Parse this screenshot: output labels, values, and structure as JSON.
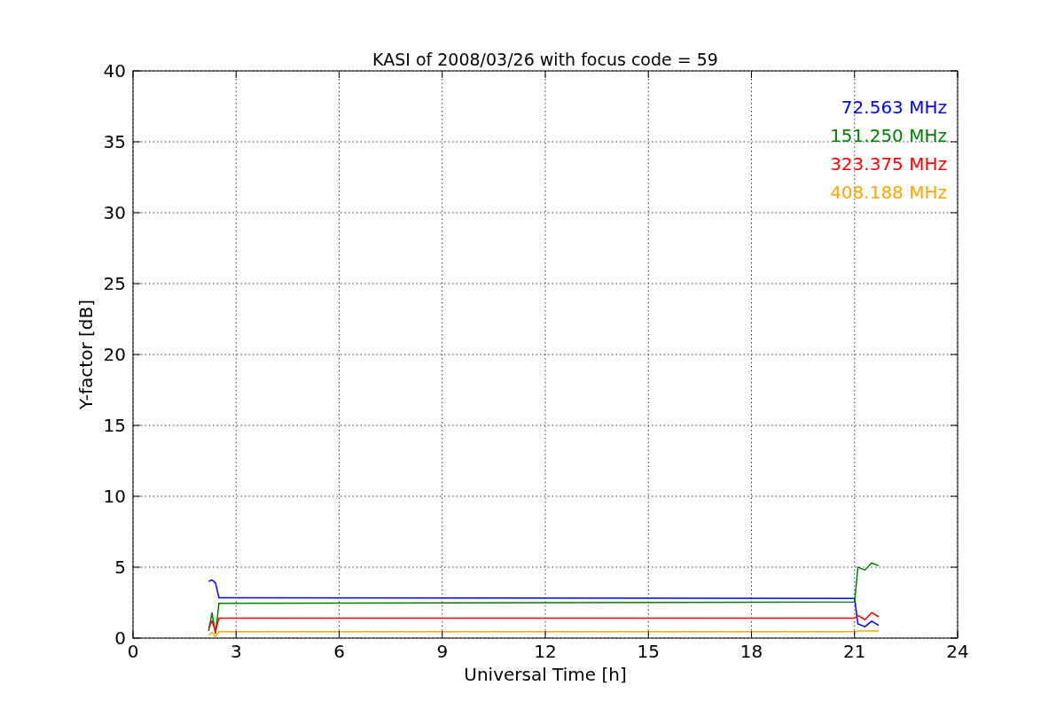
{
  "chart_data": {
    "type": "line",
    "title": "KASI of 2008/03/26 with focus code = 59",
    "xlabel": "Universal Time [h]",
    "ylabel": "Y-factor [dB]",
    "x": [
      2.2,
      2.3,
      2.4,
      2.5,
      21.0,
      21.1,
      21.3,
      21.5,
      21.7
    ],
    "series": [
      {
        "name": "72.563 MHz",
        "color": "#0000ff",
        "values": [
          4.0,
          4.1,
          3.9,
          2.85,
          2.8,
          1.0,
          0.8,
          1.2,
          0.9
        ]
      },
      {
        "name": "151.250 MHz",
        "color": "#008000",
        "values": [
          0.5,
          1.8,
          0.3,
          2.45,
          2.55,
          5.0,
          4.8,
          5.3,
          5.1
        ]
      },
      {
        "name": "323.375 MHz",
        "color": "#ff0000",
        "values": [
          0.7,
          1.2,
          0.5,
          1.4,
          1.4,
          1.6,
          1.3,
          1.8,
          1.5
        ]
      },
      {
        "name": "408.188 MHz",
        "color": "#ffa500",
        "values": [
          0.2,
          0.4,
          0.1,
          0.45,
          0.45,
          0.5,
          0.5,
          0.5,
          0.5
        ]
      }
    ],
    "xlim": [
      0,
      24
    ],
    "ylim": [
      0,
      40
    ],
    "xticks": [
      0,
      3,
      6,
      9,
      12,
      15,
      18,
      21,
      24
    ],
    "yticks": [
      0,
      5,
      10,
      15,
      20,
      25,
      30,
      35,
      40
    ],
    "grid": true
  }
}
